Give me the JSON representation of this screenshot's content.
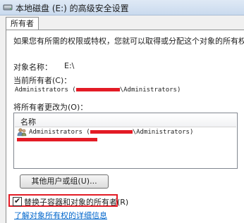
{
  "window": {
    "title": "本地磁盘 (E:) 的高级安全设置",
    "icon": "drive-icon"
  },
  "tabs": [
    {
      "label": "所有者"
    }
  ],
  "owner_panel": {
    "intro": "如果您有所需的权限或特权，您就可以取得或分配这个对象的所有权。",
    "object_name_label": "对象名称：",
    "object_name_value": "E:\\",
    "current_owner_label": "当前所有者(C)：",
    "current_owner_prefix": "Administrators (",
    "current_owner_suffix": "\\Administrators)",
    "change_to_label": "将所有者更改为(O)：",
    "list": {
      "column_header": "名称",
      "rows": [
        {
          "icon": "user-group-icon",
          "prefix": "Administrators (",
          "suffix": "\\Administrators)"
        }
      ]
    },
    "other_users_button": "其他用户或组(U)...",
    "replace_checkbox": {
      "label": "替换子容器和对象的所有者(R)",
      "checked": true
    },
    "details_link": "了解对象所有权的详细信息"
  },
  "colors": {
    "redaction": "#e31b25",
    "link": "#0066cc",
    "panel": "#ffffff",
    "chrome": "#f0f0f0"
  }
}
